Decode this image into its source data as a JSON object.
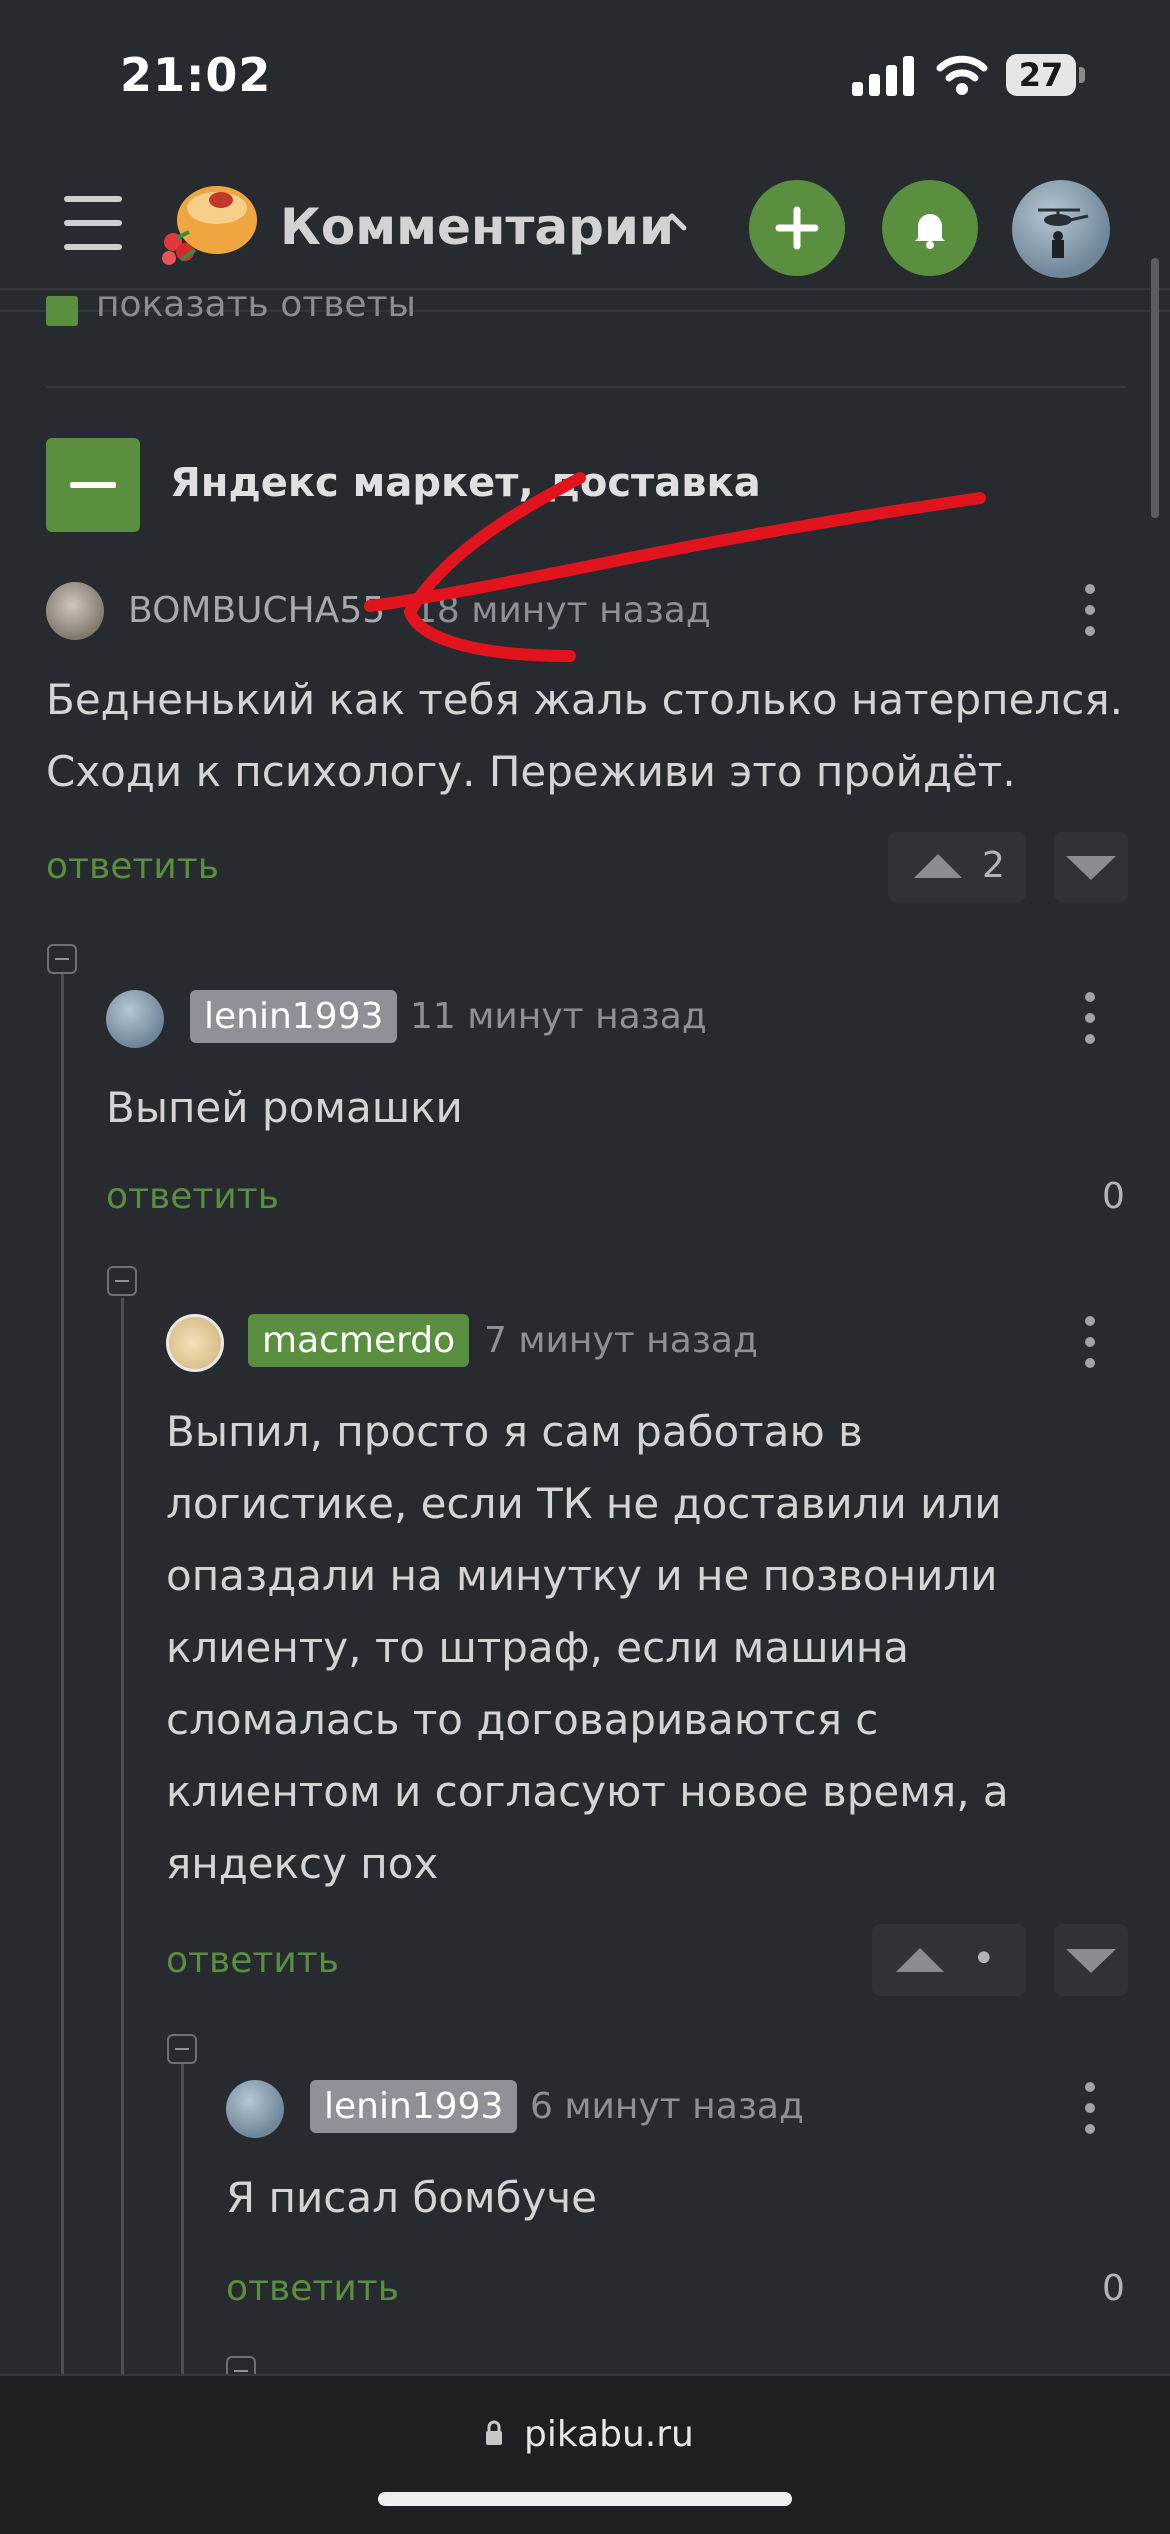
{
  "status_bar": {
    "time": "21:02",
    "battery": "27"
  },
  "header": {
    "title": "Комментарии",
    "icons": [
      "hamburger-icon",
      "pikabu-logo",
      "chevron-up-icon",
      "plus-icon",
      "bell-icon",
      "user-avatar"
    ]
  },
  "colors": {
    "background": "#272a2e",
    "accent": "#5a8f3f",
    "annotation": "#e1141e"
  },
  "cut_link": "показать ответы",
  "thread": {
    "title": "Яндекс маркет, доставка"
  },
  "comments": [
    {
      "username": "BOMBUCHA55",
      "time": "18 минут назад",
      "lines": [
        "Бедненький как тебя жаль столько натерпелся.",
        "Сходи к психологу. Переживи это пройдёт."
      ],
      "reply": "ответить",
      "rating": "2"
    },
    {
      "username": "lenin1993",
      "time": "11 минут назад",
      "lines": [
        "Выпей ромашки"
      ],
      "reply": "ответить",
      "rating": "0"
    },
    {
      "username": "macmerdo",
      "time": "7 минут назад",
      "lines": [
        "Выпил, просто я сам работаю в",
        "логистике, если ТК не доставили или",
        "опаздали на минутку и не позвонили",
        "клиенту, то штраф, если машина",
        "сломалась то договариваются с",
        "клиентом и согласуют новое время, а",
        "яндексу пох"
      ],
      "reply": "ответить",
      "rating": "•"
    },
    {
      "username": "lenin1993",
      "time": "6 минут назад",
      "lines": [
        "Я писал бомбуче"
      ],
      "reply": "ответить",
      "rating": "0"
    }
  ],
  "browser": {
    "url": "pikabu.ru"
  }
}
